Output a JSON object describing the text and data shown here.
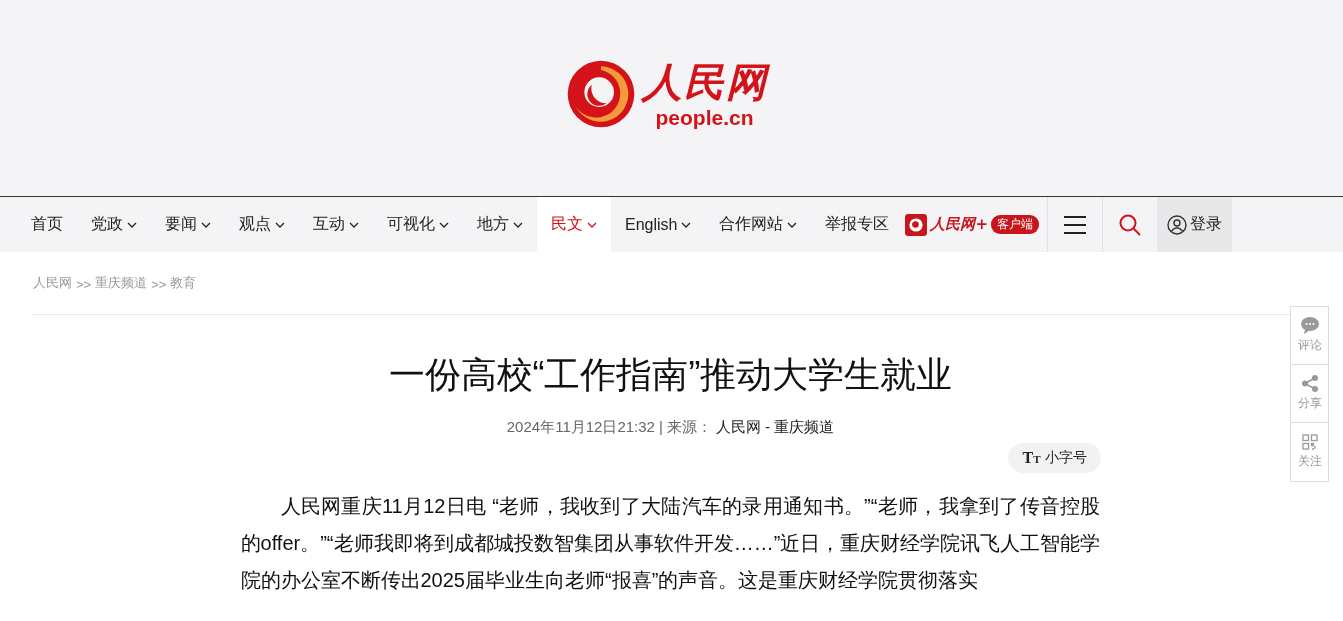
{
  "logo": {
    "name": "人民网",
    "domain": "people.cn"
  },
  "nav": [
    {
      "label": "首页",
      "dropdown": false,
      "selected": false
    },
    {
      "label": "党政",
      "dropdown": true,
      "selected": false
    },
    {
      "label": "要闻",
      "dropdown": true,
      "selected": false
    },
    {
      "label": "观点",
      "dropdown": true,
      "selected": false
    },
    {
      "label": "互动",
      "dropdown": true,
      "selected": false
    },
    {
      "label": "可视化",
      "dropdown": true,
      "selected": false
    },
    {
      "label": "地方",
      "dropdown": true,
      "selected": false
    },
    {
      "label": "民文",
      "dropdown": true,
      "selected": true
    },
    {
      "label": "English",
      "dropdown": true,
      "selected": false
    },
    {
      "label": "合作网站",
      "dropdown": true,
      "selected": false
    },
    {
      "label": "举报专区",
      "dropdown": false,
      "selected": false
    }
  ],
  "app_promo": {
    "name": "人民网+",
    "badge": "客户端"
  },
  "login": "登录",
  "breadcrumb": [
    "人民网",
    ">>",
    "重庆频道",
    ">>",
    "教育"
  ],
  "article": {
    "title": "一份高校“工作指南”推动大学生就业",
    "date": "2024年11月12日21:32",
    "separator": "|",
    "source_label": "来源：",
    "source": "人民网 - 重庆频道",
    "font_size_button": "小字号",
    "font_size_icon": "TT",
    "body": "人民网重庆11月12日电 “老师，我收到了大陆汽车的录用通知书。”“老师，我拿到了传音控股的offer。”“老师我即将到成都城投数智集团从事软件开发……”近日，重庆财经学院讯飞人工智能学院的办公室不断传出2025届毕业生向老师“报喜”的声音。这是重庆财经学院贯彻落实"
  },
  "side_tools": [
    {
      "kind": "comment",
      "label": "评论"
    },
    {
      "kind": "share",
      "label": "分享"
    },
    {
      "kind": "qr",
      "label": "关注"
    }
  ]
}
